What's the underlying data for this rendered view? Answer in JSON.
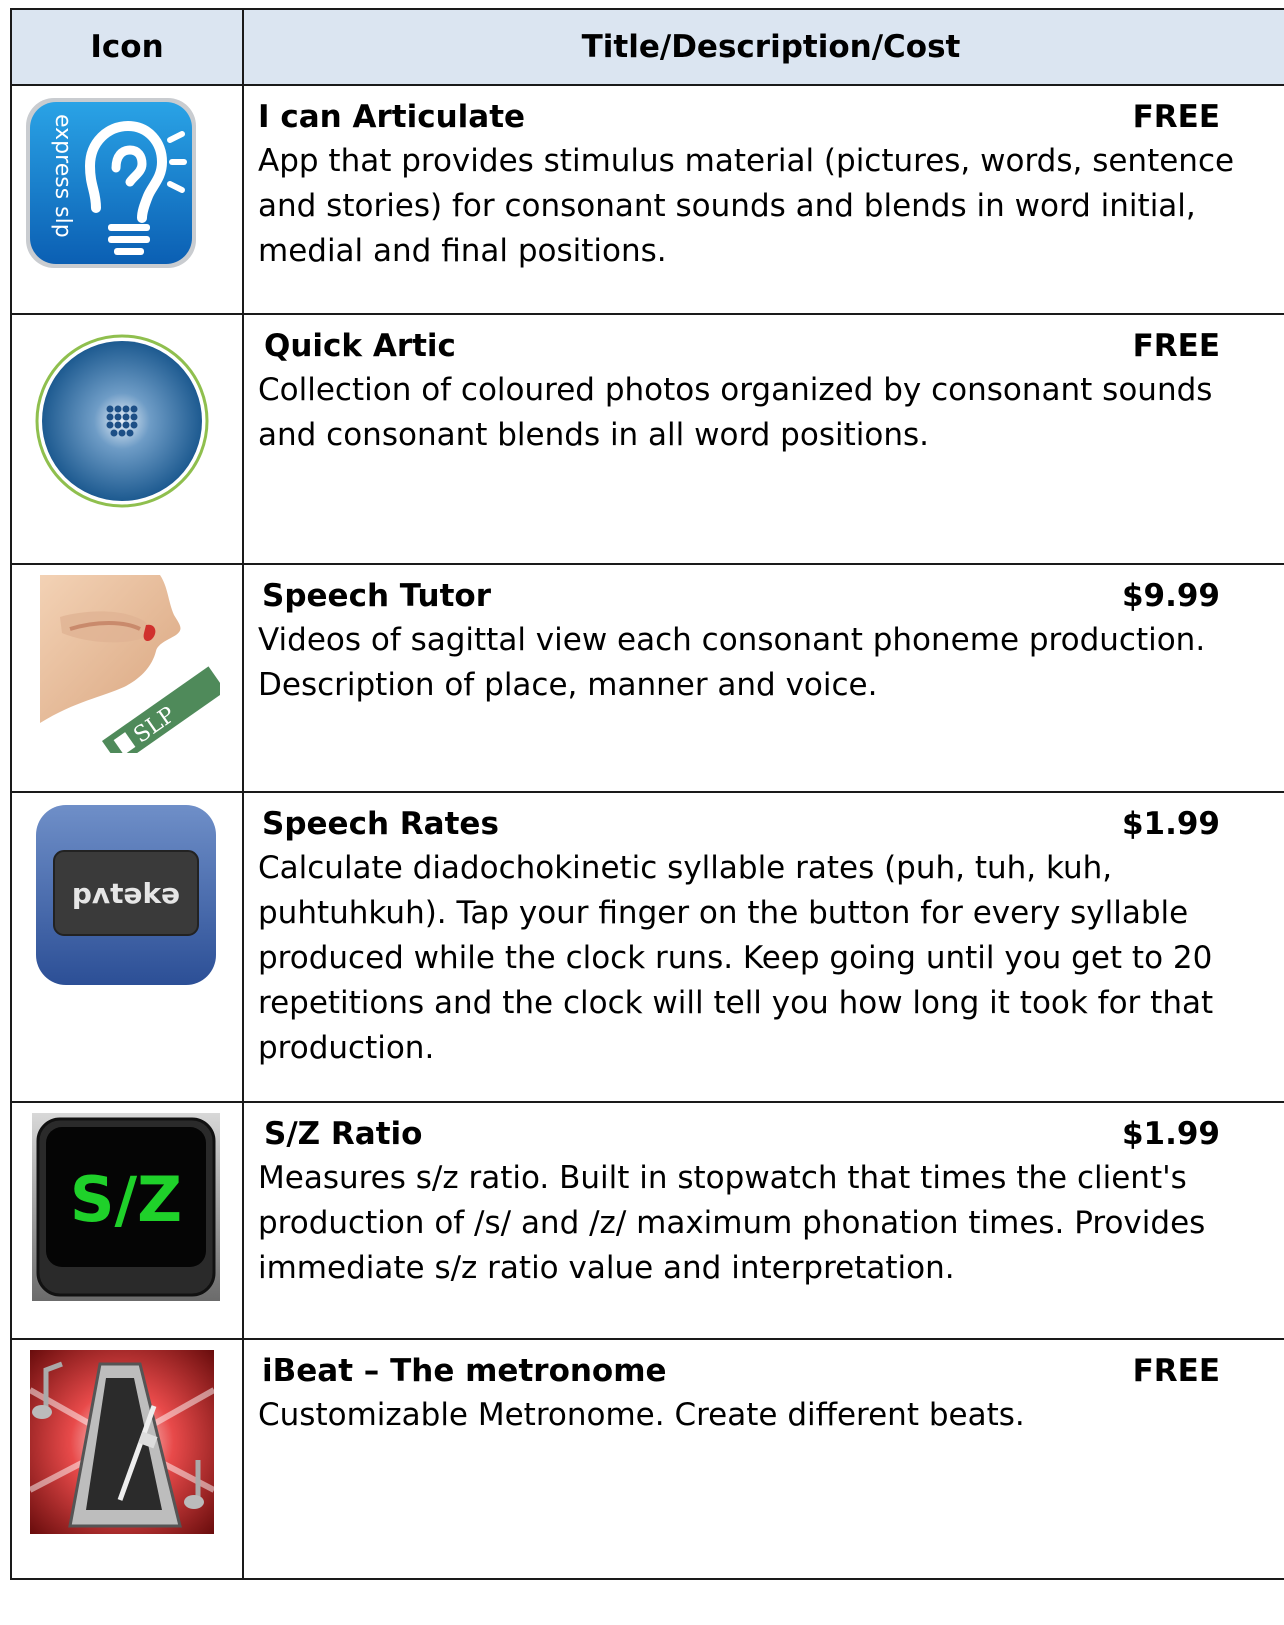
{
  "table": {
    "header": {
      "icon": "Icon",
      "details": "Title/Description/Cost"
    },
    "rows": [
      {
        "title": "I can Articulate",
        "cost": "FREE",
        "description": "App that provides stimulus material (pictures, words, sentence and stories) for consonant sounds and blends in word initial, medial and final positions.",
        "icon": "express-slp-ear-lightbulb-icon",
        "icon_text": "express slp"
      },
      {
        "title": "Quick Artic",
        "cost": "FREE",
        "description": "Collection of coloured photos organized by consonant sounds and consonant blends in all word positions.",
        "icon": "quick-artic-circle-icon"
      },
      {
        "title": "Speech Tutor",
        "cost": "$9.99",
        "description": "Videos of sagittal view each consonant phoneme production. Description of place, manner and voice.",
        "icon": "speech-tutor-mouth-icon",
        "icon_text": "SLP"
      },
      {
        "title": "Speech Rates",
        "cost": "$1.99",
        "description": "Calculate diadochokinetic syllable rates (puh, tuh, kuh, puhtuhkuh).  Tap your finger on the button for every syllable produced while the clock runs.  Keep going until you get to 20 repetitions and the clock will tell you how long it took for that production.",
        "icon": "speech-rates-pataka-icon",
        "icon_text": "pʌtəkə"
      },
      {
        "title": "S/Z Ratio",
        "cost": "$1.99",
        "description": "Measures s/z ratio.  Built in stopwatch that times the client's production of /s/ and /z/ maximum phonation times.  Provides immediate s/z ratio value and interpretation.",
        "icon": "sz-ratio-icon",
        "icon_text": "S/Z"
      },
      {
        "title": "iBeat – The metronome",
        "cost": "FREE",
        "description": "Customizable Metronome. Create different beats.",
        "icon": "metronome-icon"
      }
    ]
  },
  "colors": {
    "header_bg": "#dbe5f1",
    "border": "#1a1a1a"
  }
}
